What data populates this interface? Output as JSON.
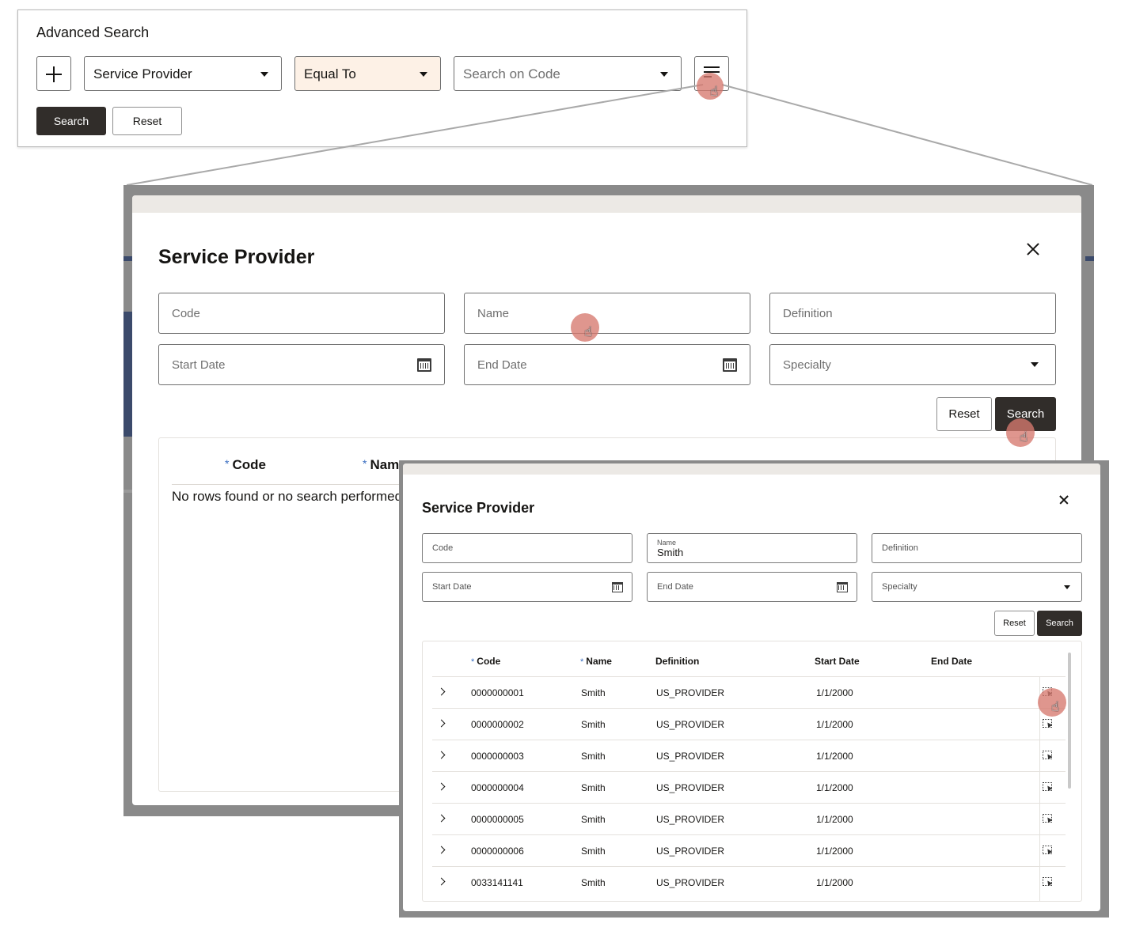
{
  "advanced_search": {
    "title": "Advanced Search",
    "field_selector": "Service Provider",
    "operator_selector": "Equal To",
    "value_placeholder": "Search on Code",
    "search_label": "Search",
    "reset_label": "Reset",
    "colors": {
      "operator_bg": "#fdf1e6",
      "dark_button": "#312d2a"
    }
  },
  "dialog_large": {
    "title": "Service Provider",
    "fields": {
      "code": "Code",
      "name": "Name",
      "definition": "Definition",
      "start_date": "Start Date",
      "end_date": "End Date",
      "specialty": "Specialty"
    },
    "reset_label": "Reset",
    "search_label": "Search",
    "table": {
      "headers": {
        "code": "Code",
        "name": "Nam"
      },
      "empty_message": "No rows found or no search performed s"
    }
  },
  "dialog_front": {
    "title": "Service Provider",
    "fields": {
      "code": "Code",
      "name_label": "Name",
      "name_value": "Smith",
      "definition": "Definition",
      "start_date": "Start Date",
      "end_date": "End Date",
      "specialty": "Specialty"
    },
    "reset_label": "Reset",
    "search_label": "Search",
    "table": {
      "headers": {
        "code": "Code",
        "name": "Name",
        "definition": "Definition",
        "start_date": "Start Date",
        "end_date": "End Date"
      },
      "rows": [
        {
          "code": "0000000001",
          "name": "Smith",
          "definition": "US_PROVIDER",
          "start_date": "1/1/2000",
          "end_date": ""
        },
        {
          "code": "0000000002",
          "name": "Smith",
          "definition": "US_PROVIDER",
          "start_date": "1/1/2000",
          "end_date": ""
        },
        {
          "code": "0000000003",
          "name": "Smith",
          "definition": "US_PROVIDER",
          "start_date": "1/1/2000",
          "end_date": ""
        },
        {
          "code": "0000000004",
          "name": "Smith",
          "definition": "US_PROVIDER",
          "start_date": "1/1/2000",
          "end_date": ""
        },
        {
          "code": "0000000005",
          "name": "Smith",
          "definition": "US_PROVIDER",
          "start_date": "1/1/2000",
          "end_date": ""
        },
        {
          "code": "0000000006",
          "name": "Smith",
          "definition": "US_PROVIDER",
          "start_date": "1/1/2000",
          "end_date": ""
        },
        {
          "code": "0033141141",
          "name": "Smith",
          "definition": "US_PROVIDER",
          "start_date": "1/1/2000",
          "end_date": ""
        }
      ]
    }
  },
  "icons": {
    "add": "plus-icon",
    "menu_search": "search-menu-icon",
    "close": "close-icon",
    "calendar": "calendar-icon",
    "dropdown": "chevron-down-icon",
    "row_expand": "chevron-right-icon",
    "row_select": "select-row-icon",
    "cursor": "hand-cursor-icon"
  }
}
